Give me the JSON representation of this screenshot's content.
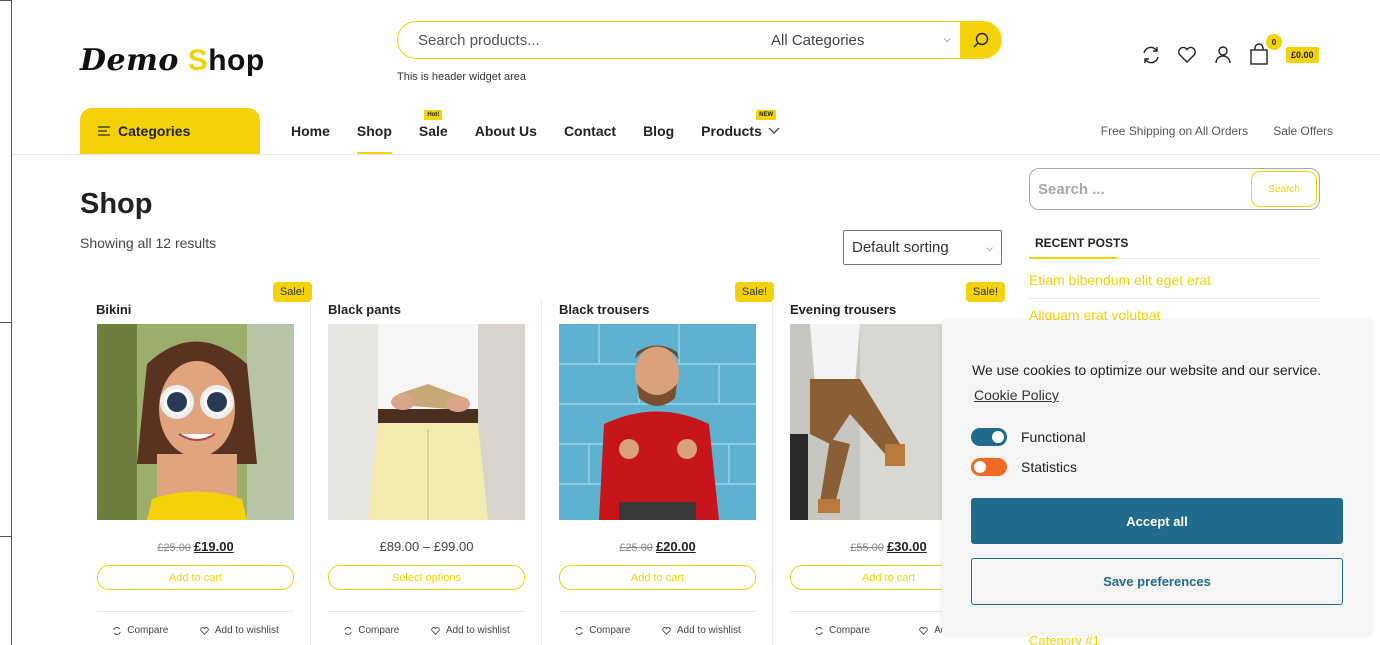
{
  "colors": {
    "accent": "#f4d20a",
    "cookie_primary": "#216b8c",
    "toggle_off": "#f06a23"
  },
  "header": {
    "logo_part1": "Demo",
    "logo_part2": "S",
    "logo_part3": "hop",
    "search_placeholder": "Search products...",
    "category_select": "All Categories",
    "widget_text": "This is header widget area",
    "cart_count": "0",
    "cart_total": "£0.00",
    "icons": [
      "compare-icon",
      "heart-icon",
      "user-icon",
      "bag-icon"
    ]
  },
  "nav": {
    "categories_label": "Categories",
    "items": [
      {
        "label": "Home",
        "badge": ""
      },
      {
        "label": "Shop",
        "badge": ""
      },
      {
        "label": "Sale",
        "badge": "Hot!"
      },
      {
        "label": "About Us",
        "badge": ""
      },
      {
        "label": "Contact",
        "badge": ""
      },
      {
        "label": "Blog",
        "badge": ""
      },
      {
        "label": "Products",
        "badge": "NEW"
      }
    ],
    "right_links": [
      "Free Shipping on All Orders",
      "Sale Offers"
    ]
  },
  "main": {
    "title": "Shop",
    "result_count": "Showing all 12 results",
    "sorting": "Default sorting",
    "products": [
      {
        "name": "Bikini",
        "sale": "Sale!",
        "old_price": "£25.00",
        "price": "£19.00",
        "button": "Add to cart"
      },
      {
        "name": "Black pants",
        "sale": "",
        "old_price": "",
        "price": "£89.00 – £99.00",
        "button": "Select options"
      },
      {
        "name": "Black trousers",
        "sale": "Sale!",
        "old_price": "£25.00",
        "price": "£20.00",
        "button": "Add to cart"
      },
      {
        "name": "Evening trousers",
        "sale": "Sale!",
        "old_price": "£55.00",
        "price": "£30.00",
        "button": "Add to cart"
      }
    ],
    "compare_label": "Compare",
    "wishlist_label": "Add to wishlist",
    "wishlist_label_partial": "Add to"
  },
  "sidebar": {
    "search_placeholder": "Search ...",
    "search_button": "Search",
    "recent_posts_title": "RECENT POSTS",
    "posts": [
      "Etiam bibendum elit eget erat",
      "Aliquam erat volutpat"
    ],
    "category_peek": "Category #1"
  },
  "cookie": {
    "message": "We use cookies to optimize our website and our service.",
    "policy_link": "Cookie Policy",
    "functional_label": "Functional",
    "statistics_label": "Statistics",
    "accept_label": "Accept all",
    "save_label": "Save preferences"
  }
}
